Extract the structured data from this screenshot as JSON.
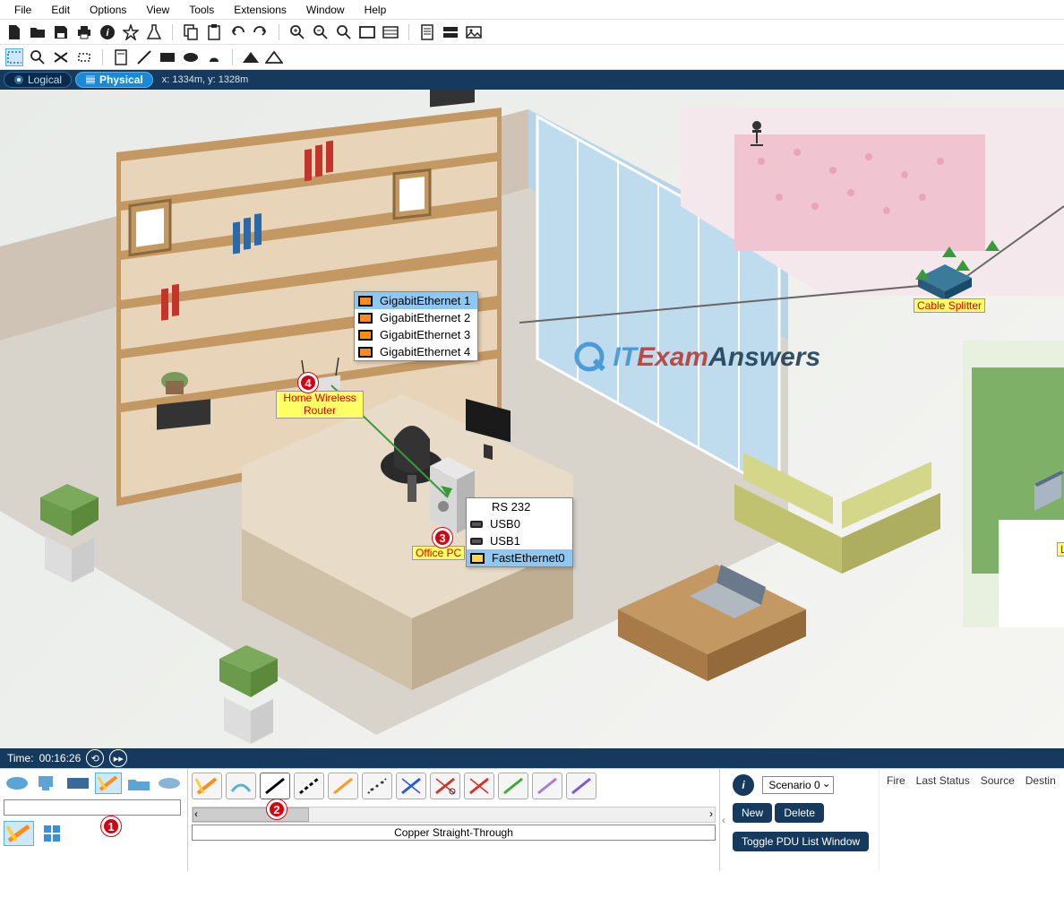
{
  "menubar": [
    "File",
    "Edit",
    "Options",
    "View",
    "Tools",
    "Extensions",
    "Window",
    "Help"
  ],
  "view": {
    "logical": "Logical",
    "physical": "Physical",
    "coords": "x: 1334m, y: 1328m"
  },
  "time": {
    "label": "Time:",
    "value": "00:16:26"
  },
  "devices": {
    "router_label": "Home Wireless\nRouter",
    "pc_label": "Office PC",
    "splitter_label": "Cable Splitter",
    "laptop_label_partial": "L"
  },
  "port_menu_router": {
    "items": [
      {
        "icon": "orange",
        "label": "GigabitEthernet 1",
        "selected": true
      },
      {
        "icon": "orange",
        "label": "GigabitEthernet 2"
      },
      {
        "icon": "orange",
        "label": "GigabitEthernet 3"
      },
      {
        "icon": "orange",
        "label": "GigabitEthernet 4"
      }
    ]
  },
  "port_menu_pc": {
    "items": [
      {
        "icon": "none",
        "label": "RS 232"
      },
      {
        "icon": "black",
        "label": "USB0"
      },
      {
        "icon": "black",
        "label": "USB1"
      },
      {
        "icon": "yellow",
        "label": "FastEthernet0",
        "selected": true
      }
    ]
  },
  "callouts": {
    "c1": "1",
    "c2": "2",
    "c3": "3",
    "c4": "4"
  },
  "watermark": {
    "it": "IT",
    "exam": "Exam",
    "ans": "Answers"
  },
  "bottom": {
    "cable_name": "Copper Straight-Through",
    "scenario": "Scenario 0",
    "new_btn": "New",
    "delete_btn": "Delete",
    "toggle_btn": "Toggle PDU List Window",
    "pdu_headers": [
      "Fire",
      "Last Status",
      "Source",
      "Destin"
    ]
  }
}
